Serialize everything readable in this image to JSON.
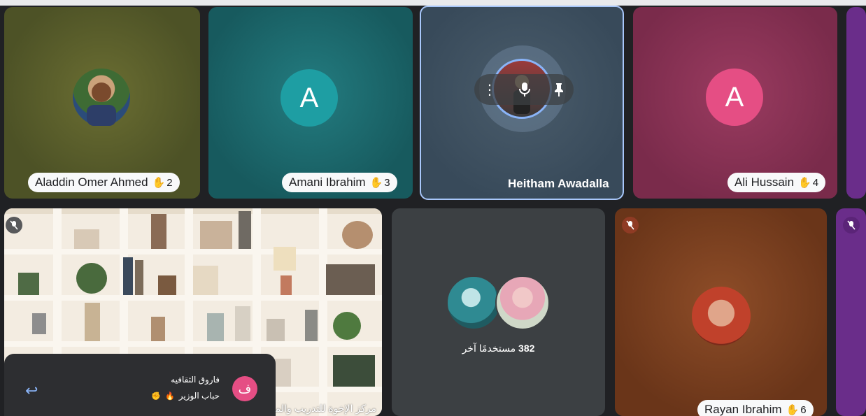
{
  "participants": [
    {
      "name": "Aladdin Omer Ahmed",
      "hand": "2"
    },
    {
      "name": "Amani Ibrahim",
      "hand": "3",
      "initial": "A"
    },
    {
      "name": "Heitham Awadalla"
    },
    {
      "name": "Ali Hussain",
      "hand": "4",
      "initial": "A"
    },
    {
      "name": "Rayan Ibrahim",
      "hand": "6"
    }
  ],
  "others": {
    "count": "382",
    "label": "مستخدمًا آخر"
  },
  "shelf_caption": "مركز الإخوة للتدريب والمحاسبة",
  "chat": {
    "avatar_initial": "ف",
    "line1": "فاروق الثقافيه",
    "line2": "حباب الوزير",
    "reactions": [
      "✊",
      "🔥"
    ]
  },
  "colors": {
    "tile1": "#5b5f2c",
    "tile2": "#1d6b6f",
    "tile3": "#3f5262",
    "tile4": "#8d3457",
    "accent_teal": "#1e9ea3",
    "accent_pink": "#e54e84",
    "rayan_tile": "#7a3d1e",
    "purple": "#6a2d8a"
  },
  "icons": [
    "hand-raised-icon",
    "mic-off-icon",
    "more-vert-icon",
    "mic-icon",
    "pin-icon",
    "reply-arrow-icon"
  ]
}
